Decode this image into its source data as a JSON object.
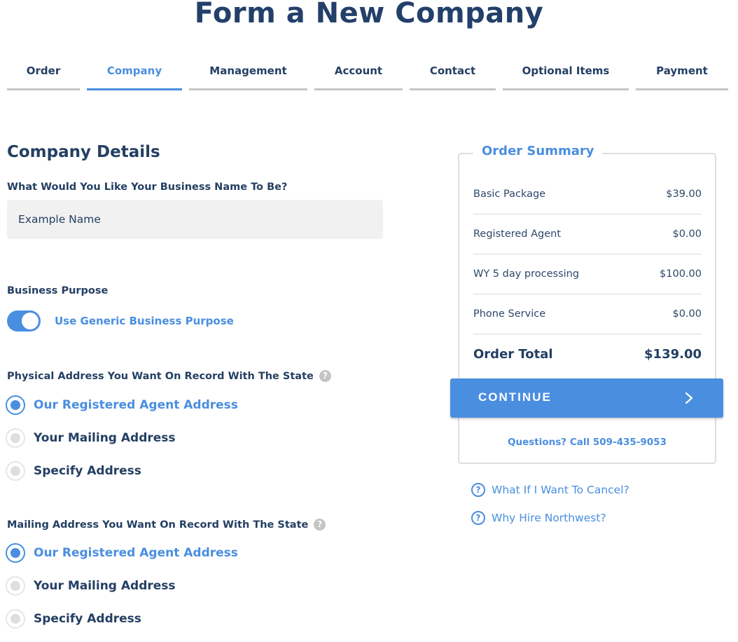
{
  "page": {
    "title": "Form a New Company"
  },
  "tabs": [
    {
      "label": "Order",
      "active": false
    },
    {
      "label": "Company",
      "active": true
    },
    {
      "label": "Management",
      "active": false
    },
    {
      "label": "Account",
      "active": false
    },
    {
      "label": "Contact",
      "active": false
    },
    {
      "label": "Optional Items",
      "active": false
    },
    {
      "label": "Payment",
      "active": false
    }
  ],
  "form": {
    "section_title": "Company Details",
    "business_name": {
      "label": "What Would You Like Your Business Name To Be?",
      "placeholder": "Example Name",
      "value": ""
    },
    "business_purpose": {
      "label": "Business Purpose",
      "toggle_label": "Use Generic Business Purpose",
      "toggle_on": true
    },
    "physical_address": {
      "label": "Physical Address You Want On Record With The State",
      "help_icon": "question-circle-icon",
      "options": [
        {
          "label": "Our Registered Agent Address",
          "checked": true
        },
        {
          "label": "Your Mailing Address",
          "checked": false
        },
        {
          "label": "Specify Address",
          "checked": false
        }
      ]
    },
    "mailing_address": {
      "label": "Mailing Address You Want On Record With The State",
      "help_icon": "question-circle-icon",
      "options": [
        {
          "label": "Our Registered Agent Address",
          "checked": true
        },
        {
          "label": "Your Mailing Address",
          "checked": false
        },
        {
          "label": "Specify Address",
          "checked": false
        }
      ]
    }
  },
  "summary": {
    "title": "Order Summary",
    "items": [
      {
        "label": "Basic Package",
        "price": "$39.00"
      },
      {
        "label": "Registered Agent",
        "price": "$0.00"
      },
      {
        "label": "WY 5 day processing",
        "price": "$100.00"
      },
      {
        "label": "Phone Service",
        "price": "$0.00"
      }
    ],
    "total_label": "Order Total",
    "total_price": "$139.00",
    "continue_label": "CONTINUE",
    "phone_text": "Questions? Call 509-435-9053"
  },
  "faq": [
    {
      "icon": "question-circle-icon",
      "label": "What If I Want To Cancel?"
    },
    {
      "icon": "question-circle-icon",
      "label": "Why Hire Northwest?"
    }
  ],
  "colors": {
    "accent": "#4a8ee0",
    "heading": "#23406a",
    "inactive_tab_bar": "#c5c5c5",
    "input_bg": "#f1f1f1"
  }
}
